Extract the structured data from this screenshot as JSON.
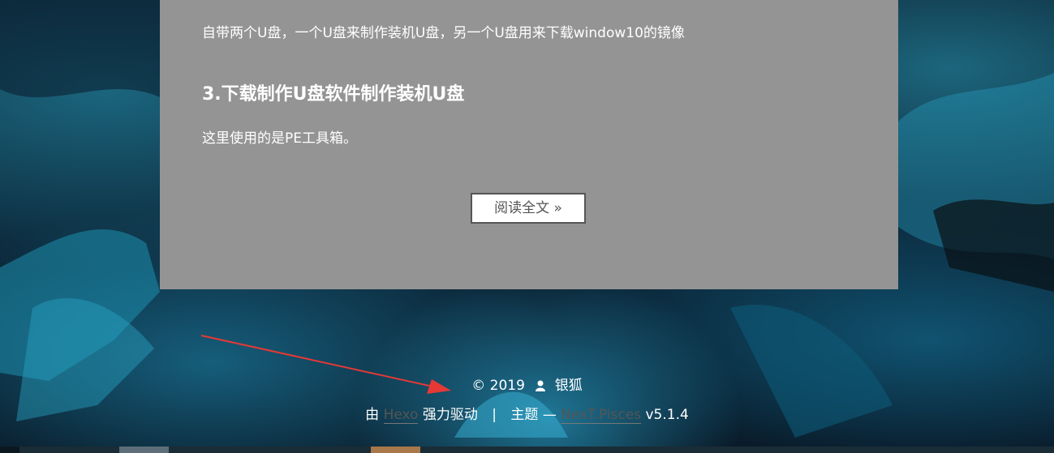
{
  "post": {
    "text1": "自带两个U盘，一个U盘来制作装机U盘，另一个U盘用来下载window10的镜像",
    "heading": "3.下载制作U盘软件制作装机U盘",
    "text2": "这里使用的是PE工具箱。",
    "read_more": "阅读全文 »"
  },
  "footer": {
    "copyright": "© 2019",
    "author": "银狐",
    "powered_prefix": "由",
    "hexo_link": "Hexo",
    "powered_suffix": "强力驱动",
    "separator": "|",
    "theme_prefix": "主题 —",
    "theme_link": "NexT.Pisces",
    "version": "v5.1.4"
  },
  "colors": {
    "card_bg": "#949494",
    "annotation_arrow": "#e53935"
  }
}
